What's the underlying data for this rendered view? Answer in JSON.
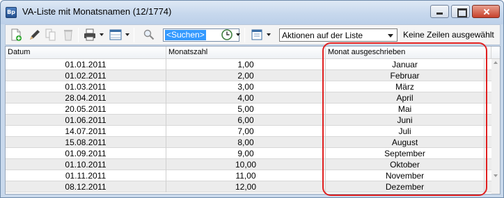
{
  "window": {
    "title": "VA-Liste mit Monatsnamen (12/1774)",
    "app_icon_text": "Bp"
  },
  "toolbar": {
    "search_placeholder": "<Suchen>",
    "actions_value": "Aktionen auf der Liste",
    "selection_status": "Keine Zeilen ausgewählt",
    "icons": [
      "add-document-icon",
      "edit-pencil-icon",
      "copy-document-icon",
      "delete-trash-icon",
      "print-icon",
      "table-view-icon",
      "search-icon",
      "history-clock-icon",
      "export-list-icon"
    ]
  },
  "grid": {
    "columns": [
      "Datum",
      "Monatszahl",
      "Monat ausgeschrieben"
    ],
    "rows": [
      {
        "datum": "01.01.2011",
        "zahl": "1,00",
        "monat": "Januar"
      },
      {
        "datum": "01.02.2011",
        "zahl": "2,00",
        "monat": "Februar"
      },
      {
        "datum": "01.03.2011",
        "zahl": "3,00",
        "monat": "März"
      },
      {
        "datum": "28.04.2011",
        "zahl": "4,00",
        "monat": "April"
      },
      {
        "datum": "20.05.2011",
        "zahl": "5,00",
        "monat": "Mai"
      },
      {
        "datum": "01.06.2011",
        "zahl": "6,00",
        "monat": "Juni"
      },
      {
        "datum": "14.07.2011",
        "zahl": "7,00",
        "monat": "Juli"
      },
      {
        "datum": "15.08.2011",
        "zahl": "8,00",
        "monat": "August"
      },
      {
        "datum": "01.09.2011",
        "zahl": "9,00",
        "monat": "September"
      },
      {
        "datum": "01.10.2011",
        "zahl": "10,00",
        "monat": "Oktober"
      },
      {
        "datum": "01.11.2011",
        "zahl": "11,00",
        "monat": "November"
      },
      {
        "datum": "08.12.2011",
        "zahl": "12,00",
        "monat": "Dezember"
      }
    ]
  },
  "colors": {
    "highlight": "#e02020",
    "selection": "#3399ff",
    "row_alt": "#ececec"
  }
}
